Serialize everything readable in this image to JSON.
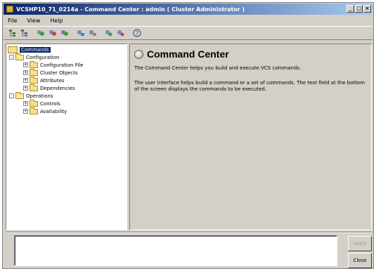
{
  "window": {
    "title": "VCSHP10_71_0214a - Command Center : admin ( Cluster Administrator )",
    "controls": [
      "_",
      "□",
      "×"
    ]
  },
  "menubar": {
    "items": [
      {
        "label": "File"
      },
      {
        "label": "View"
      },
      {
        "label": "Help"
      }
    ]
  },
  "toolbar": {
    "buttons": [
      {
        "icon": "tree-view-icon"
      },
      {
        "icon": "tree-view-icon"
      },
      {
        "icon": "group-icon"
      },
      {
        "icon": "group-icon"
      },
      {
        "icon": "resource-icon"
      },
      {
        "icon": "resource-icon"
      },
      {
        "icon": "system-icon"
      },
      {
        "icon": "system-icon"
      },
      {
        "icon": "online-icon"
      },
      {
        "icon": "offline-icon"
      },
      {
        "icon": "help-icon"
      }
    ]
  },
  "tree": {
    "root": {
      "label": "Commands"
    },
    "nodes": [
      {
        "label": "Configuration",
        "expander": "-",
        "level": 1
      },
      {
        "label": "Configuration File",
        "expander": "+",
        "level": 2
      },
      {
        "label": "Cluster Objects",
        "expander": "+",
        "level": 2
      },
      {
        "label": "Attributes",
        "expander": "+",
        "level": 2
      },
      {
        "label": "Dependencies",
        "expander": "+",
        "level": 2
      },
      {
        "label": "Operations",
        "expander": "-",
        "level": 1
      },
      {
        "label": "Controls",
        "expander": "+",
        "level": 2
      },
      {
        "label": "Availability",
        "expander": "+",
        "level": 2
      }
    ]
  },
  "detail": {
    "title": "Command Center",
    "paragraph1": "The Command Center helps you build and execute VCS commands.",
    "paragraph2": "The user interface helps build a command or a set of commands. The text field at the bottom of the screen displays the commands to be executed."
  },
  "command_field": {
    "value": ""
  },
  "buttons": {
    "apply": "Apply",
    "close": "Close"
  },
  "colors": {
    "titlebar_start": "#0a246a",
    "titlebar_end": "#a6caf0",
    "window_bg": "#d4d0c8",
    "selection": "#0a246a"
  }
}
